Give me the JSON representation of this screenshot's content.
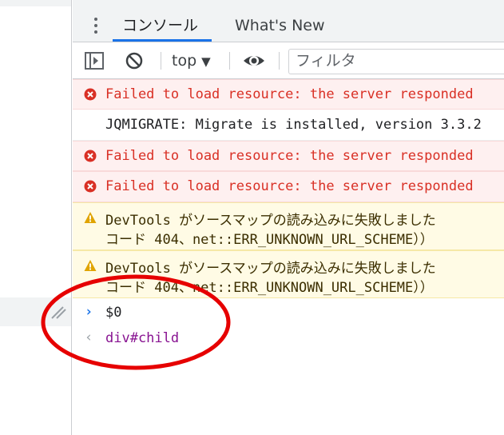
{
  "tabs": [
    {
      "label": "コンソール",
      "active": true
    },
    {
      "label": "What's New",
      "active": false
    }
  ],
  "toolbar": {
    "context_label": "top",
    "filter_placeholder": "フィルタ"
  },
  "messages": [
    {
      "level": "error",
      "text": "Failed to load resource: the server responded"
    },
    {
      "level": "log",
      "text": "JQMIGRATE: Migrate is installed, version 3.3.2"
    },
    {
      "level": "error",
      "text": "Failed to load resource: the server responded"
    },
    {
      "level": "error",
      "text": "Failed to load resource: the server responded"
    },
    {
      "level": "warning",
      "line1": "DevTools がソースマップの読み込みに失敗しました",
      "line2": "コード 404、net::ERR_UNKNOWN_URL_SCHEME））"
    },
    {
      "level": "warning",
      "line1": "DevTools がソースマップの読み込みに失敗しました",
      "line2": "コード 404、net::ERR_UNKNOWN_URL_SCHEME））"
    }
  ],
  "console_input": {
    "prompt": "›",
    "text": "$0"
  },
  "console_result": {
    "prompt": "‹",
    "text": "div#child"
  },
  "colors": {
    "accent": "#1a73e8",
    "error_text": "#d93025",
    "error_bg": "#fef0f0",
    "warning_bg": "#fffbe5",
    "warning_icon": "#e0a400",
    "result_text": "#881391",
    "annotation_circle": "#e60000"
  },
  "icons": {
    "menu": "kebab-menu-icon",
    "sidebar": "sidebar-toggle-icon",
    "clear": "clear-console-icon",
    "context_dropdown": "chevron-down-icon",
    "live_expression": "eye-icon",
    "error": "error-icon",
    "warning": "warning-icon",
    "resize": "resize-handle-icon"
  }
}
